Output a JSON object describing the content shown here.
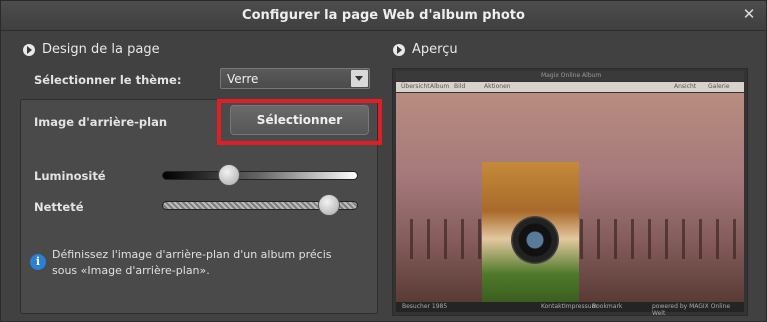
{
  "window": {
    "title": "Configurer la page Web d'album photo",
    "close_icon": "close-icon"
  },
  "design": {
    "heading": "Design de la page",
    "theme_label": "Sélectionner le thème:",
    "theme_value": "Verre",
    "background_label": "Image d'arrière-plan",
    "select_button": "Sélectionner",
    "brightness_label": "Luminosité",
    "brightness_value": 0.34,
    "sharpness_label": "Netteté",
    "sharpness_value": 0.85,
    "info_text": "Définissez l'image d'arrière-plan d'un album précis sous «Image d'arrière-plan»."
  },
  "preview": {
    "heading": "Aperçu",
    "app_title": "Magix Online Album",
    "breadcrumb": [
      "Übersicht",
      "Album",
      "Bild"
    ],
    "toolbar_action": "Aktionen",
    "toolbar_view_label": "Ansicht",
    "toolbar_view_value": "Galerie",
    "status_left": "Besucher 1985",
    "status_links": [
      "Kontakt",
      "Impressum",
      "Bookmark"
    ],
    "status_right": "powered by MAGIX Online Welt"
  },
  "colors": {
    "highlight": "#e01e25",
    "info": "#2b7fd4"
  }
}
